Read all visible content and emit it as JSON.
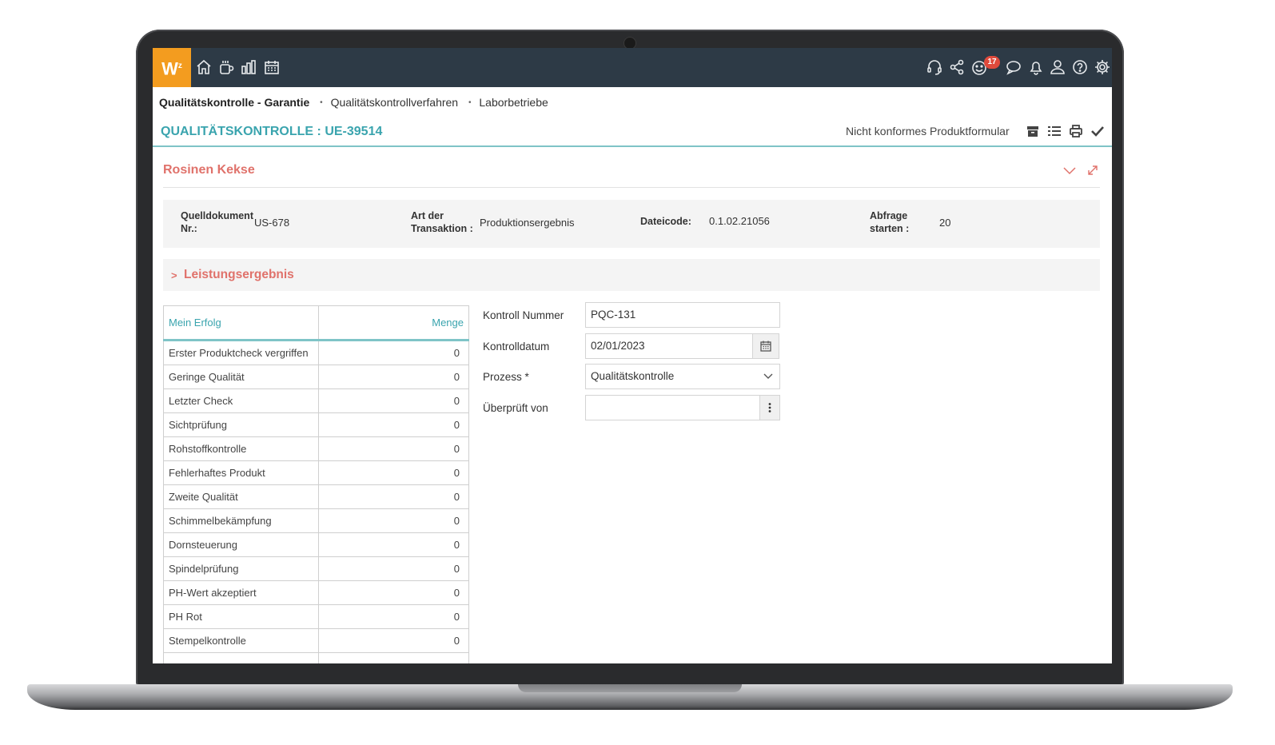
{
  "app": {
    "logo_text": "W",
    "logo_sup": "z",
    "nav_icons": [
      "home-icon",
      "coffee-icon",
      "chart-icon",
      "calendar-icon"
    ],
    "right_icons": [
      "headset-icon",
      "share-icon",
      "smiley-icon",
      "chat-icon",
      "bell-icon",
      "user-icon",
      "help-icon",
      "gear-icon"
    ],
    "notification_count": "17",
    "colors": {
      "topbar": "#2d3a46",
      "logo": "#f39c1f",
      "accent": "#3aa4ae",
      "section": "#e0726b",
      "badge": "#e04a3c"
    }
  },
  "breadcrumb": {
    "items": [
      "Qualitätskontrolle - Garantie",
      "Qualitätskontrollverfahren",
      "Laborbetriebe"
    ]
  },
  "header": {
    "title": "QUALITÄTSKONTROLLE : UE-39514",
    "form_link": "Nicht konformes Produktformular",
    "tools": [
      "archive-icon",
      "list-icon",
      "print-icon",
      "check-icon"
    ]
  },
  "section": {
    "title": "Rosinen Kekse",
    "info": {
      "source_label": "Quelldokument Nr.:",
      "source_value": "US-678",
      "type_label": "Art der Transaktion :",
      "type_value": "Produktionsergebnis",
      "file_label": "Dateicode:",
      "file_value": "0.1.02.21056",
      "query_label": "Abfrage starten :",
      "query_value": "20"
    },
    "subsection_title": "Leistungsergebnis"
  },
  "results": {
    "headers": [
      "Mein Erfolg",
      "Menge"
    ],
    "rows": [
      {
        "name": "Erster Produktcheck vergriffen",
        "qty": "0"
      },
      {
        "name": "Geringe Qualität",
        "qty": "0"
      },
      {
        "name": "Letzter Check",
        "qty": "0"
      },
      {
        "name": "Sichtprüfung",
        "qty": "0"
      },
      {
        "name": "Rohstoffkontrolle",
        "qty": "0"
      },
      {
        "name": "Fehlerhaftes Produkt",
        "qty": "0"
      },
      {
        "name": "Zweite Qualität",
        "qty": "0"
      },
      {
        "name": "Schimmelbekämpfung",
        "qty": "0"
      },
      {
        "name": "Dornsteuerung",
        "qty": "0"
      },
      {
        "name": "Spindelprüfung",
        "qty": "0"
      },
      {
        "name": "PH-Wert akzeptiert",
        "qty": "0"
      },
      {
        "name": "PH Rot",
        "qty": "0"
      },
      {
        "name": "Stempelkontrolle",
        "qty": "0"
      }
    ]
  },
  "form": {
    "control_number_label": "Kontroll Nummer",
    "control_number_value": "PQC-131",
    "control_date_label": "Kontrolldatum",
    "control_date_value": "02/01/2023",
    "process_label": "Prozess *",
    "process_value": "Qualitätskontrolle",
    "checked_by_label": "Überprüft von",
    "checked_by_value": ""
  }
}
